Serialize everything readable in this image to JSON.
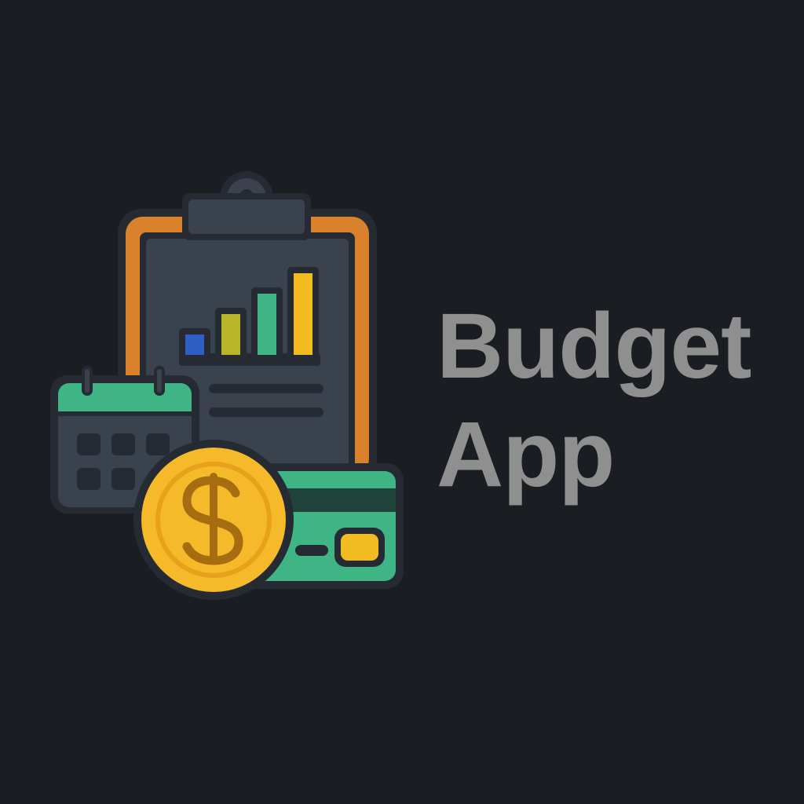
{
  "brand": {
    "name_line_1": "Budget",
    "name_line_2": "App"
  },
  "icons": [
    "clipboard-icon",
    "bar-chart-icon",
    "calendar-icon",
    "dollar-coin-icon",
    "credit-card-icon"
  ],
  "colors": {
    "background": "#1a1e22",
    "wordmark": "#8f8f8f",
    "clipboard_frame": "#d9822b",
    "clipboard_board": "#3a424e",
    "outline": "#262b33",
    "bar_blue": "#2f5ec4",
    "bar_olive": "#b8b626",
    "bar_green": "#3fb585",
    "bar_yellow": "#f2bb22",
    "calendar_header": "#3fb585",
    "card_green": "#3fb585",
    "card_stripe": "#22433b",
    "card_chip": "#f2bb22",
    "coin_gold": "#f5b92a",
    "coin_inner": "#e8a11b",
    "coin_symbol": "#a66d10"
  },
  "chart_data": {
    "type": "bar",
    "categories": [
      "",
      "",
      "",
      ""
    ],
    "values": [
      1,
      2,
      3,
      4
    ],
    "colors": [
      "#2f5ec4",
      "#b8b626",
      "#3fb585",
      "#f2bb22"
    ]
  }
}
